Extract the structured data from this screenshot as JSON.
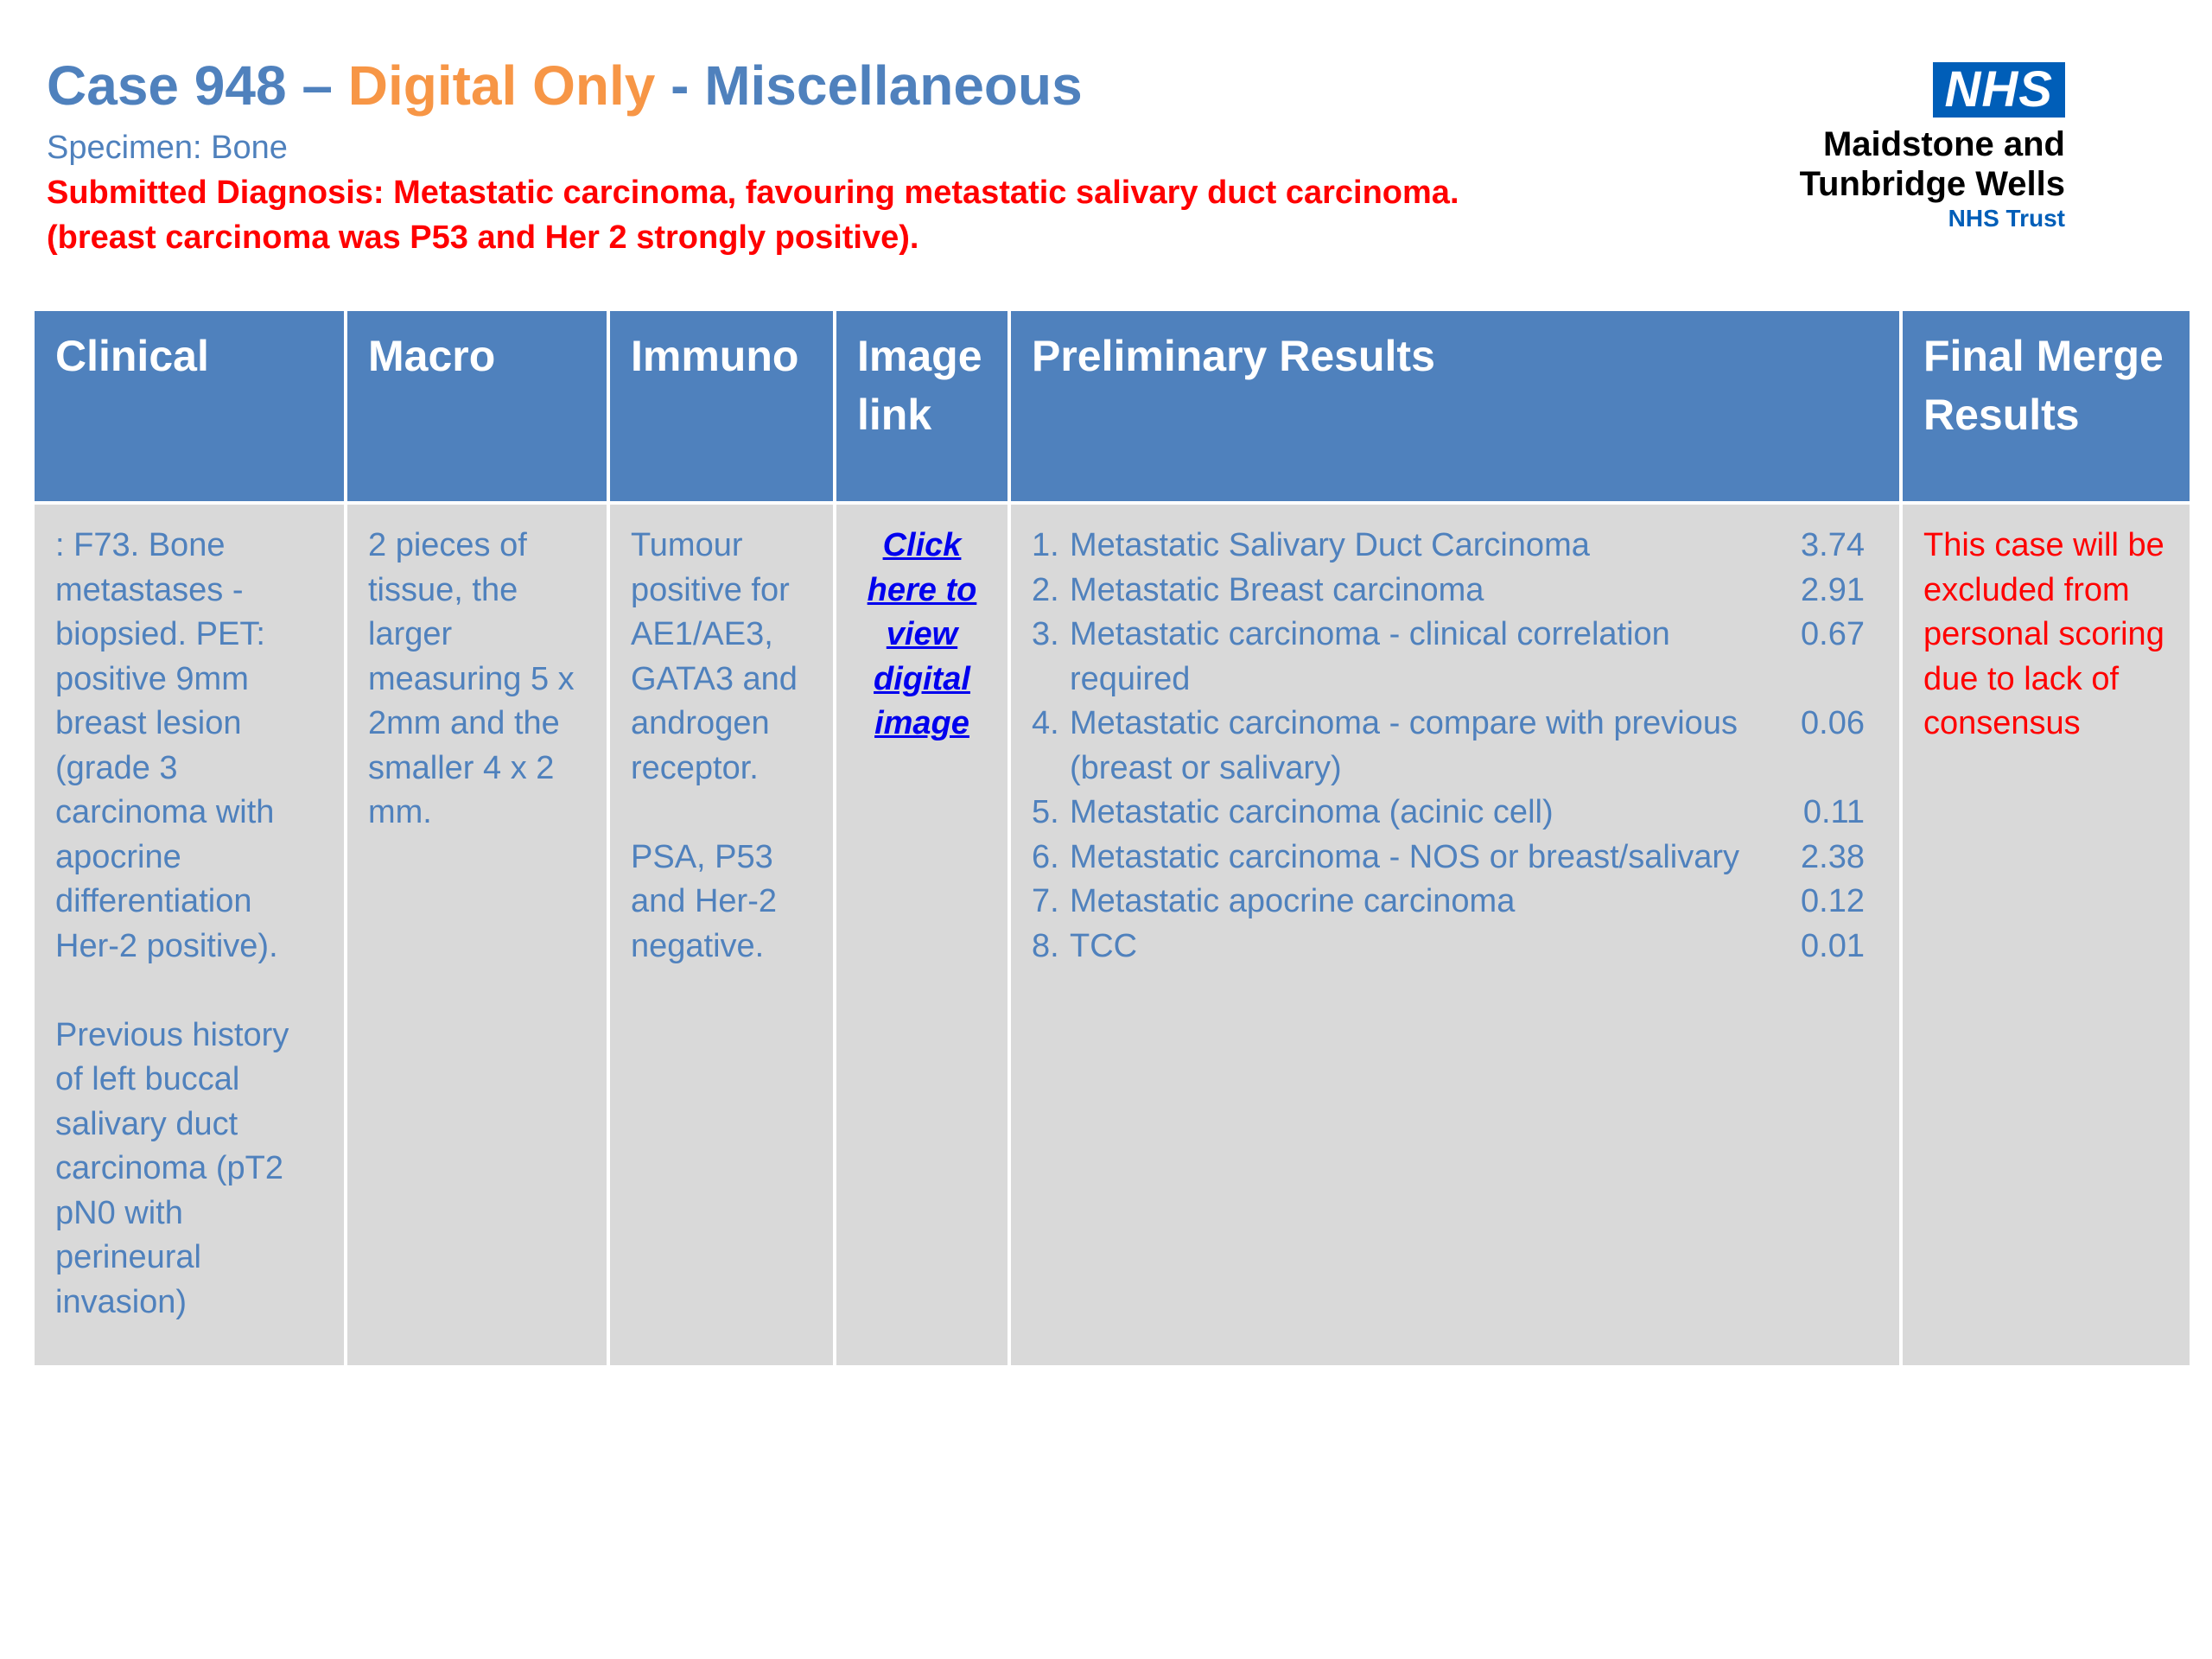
{
  "header": {
    "title_part1": "Case 948 – ",
    "title_part2": "Digital Only",
    "title_part3": " - Miscellaneous",
    "specimen": "Specimen: Bone",
    "diagnosis_line1": "Submitted Diagnosis: Metastatic carcinoma, favouring metastatic salivary duct carcinoma.",
    "diagnosis_line2": "(breast carcinoma was P53 and Her 2 strongly positive)."
  },
  "logo": {
    "nhs": "NHS",
    "org_line1": "Maidstone and",
    "org_line2": "Tunbridge Wells",
    "trust": "NHS Trust"
  },
  "table": {
    "headers": {
      "clinical": "Clinical",
      "macro": "Macro",
      "immuno": "Immuno",
      "image_link": "Image link",
      "preliminary": "Preliminary Results",
      "final": "Final Merge Results"
    },
    "clinical": {
      "p1": ": F73. Bone metastases - biopsied. PET: positive 9mm breast lesion (grade 3 carcinoma with apocrine differentiation Her-2 positive).",
      "p2": "Previous history of left buccal salivary duct carcinoma (pT2 pN0 with perineural invasion)"
    },
    "macro": "2 pieces of tissue, the larger measuring 5 x 2mm and the smaller 4 x 2 mm.",
    "immuno": {
      "p1": "Tumour positive for AE1/AE3, GATA3 and androgen receptor.",
      "p2": "PSA, P53 and Her-2 negative."
    },
    "image_link_text": "Click here to view digital image",
    "preliminary": [
      {
        "num": "1.",
        "text": "Metastatic Salivary Duct Carcinoma",
        "score": "3.74"
      },
      {
        "num": "2.",
        "text": "Metastatic Breast carcinoma",
        "score": "2.91"
      },
      {
        "num": "3.",
        "text": "Metastatic carcinoma - clinical correlation required",
        "score": "0.67"
      },
      {
        "num": "4.",
        "text": "Metastatic carcinoma - compare with previous (breast or salivary)",
        "score": "0.06"
      },
      {
        "num": "5.",
        "text": "Metastatic carcinoma (acinic cell)",
        "score": "0.11"
      },
      {
        "num": "6.",
        "text": "Metastatic carcinoma - NOS or breast/salivary",
        "score": "2.38"
      },
      {
        "num": "7.",
        "text": "Metastatic apocrine carcinoma",
        "score": "0.12"
      },
      {
        "num": "8.",
        "text": "TCC",
        "score": "0.01"
      }
    ],
    "final": "This case will be excluded from personal scoring due to lack of consensus"
  }
}
